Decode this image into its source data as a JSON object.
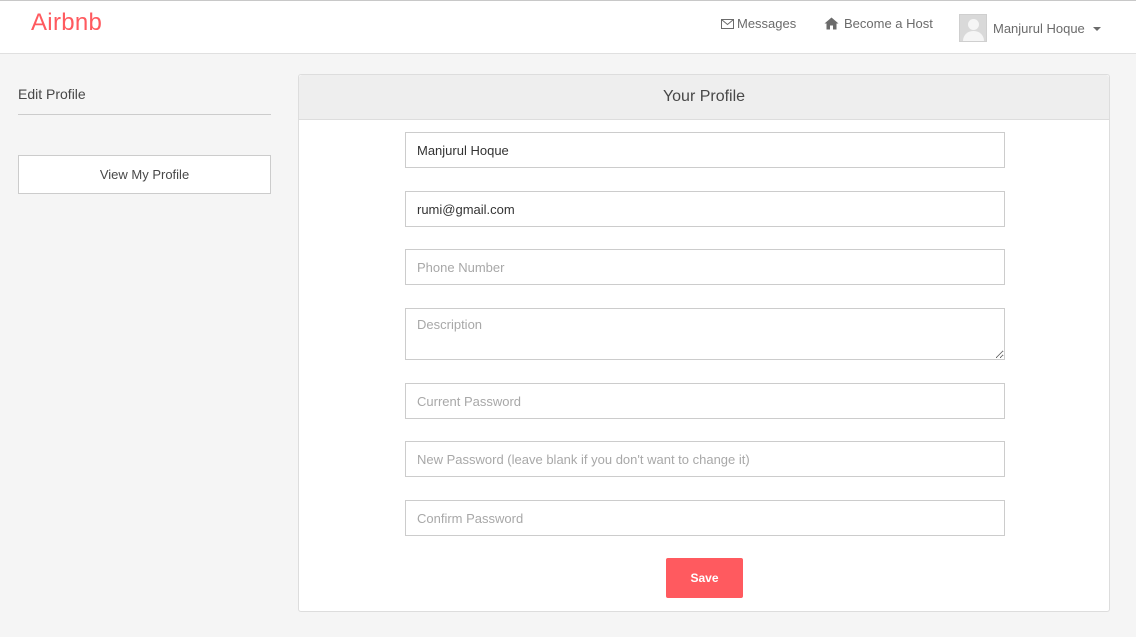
{
  "navbar": {
    "brand": "Airbnb",
    "messages": {
      "label": "Messages",
      "icon": "envelope-icon"
    },
    "become_host": {
      "label": "Become a Host",
      "icon": "home-icon"
    },
    "user": {
      "name": "Manjurul Hoque",
      "avatar": "avatar-placeholder",
      "icon": "caret-down-icon"
    }
  },
  "sidebar": {
    "title": "Edit Profile",
    "view_profile_label": "View My Profile"
  },
  "panel": {
    "title": "Your Profile"
  },
  "form": {
    "name": {
      "value": "Manjurul Hoque",
      "placeholder": ""
    },
    "email": {
      "value": "rumi@gmail.com",
      "placeholder": ""
    },
    "phone": {
      "value": "",
      "placeholder": "Phone Number"
    },
    "description": {
      "value": "",
      "placeholder": "Description"
    },
    "current_password": {
      "value": "",
      "placeholder": "Current Password"
    },
    "new_password": {
      "value": "",
      "placeholder": "New Password (leave blank if you don't want to change it)"
    },
    "confirm_password": {
      "value": "",
      "placeholder": "Confirm Password"
    },
    "save_label": "Save"
  },
  "colors": {
    "brand": "#ff5a5f",
    "panel_heading_bg": "#eeeeee",
    "page_bg": "#f5f5f5"
  }
}
